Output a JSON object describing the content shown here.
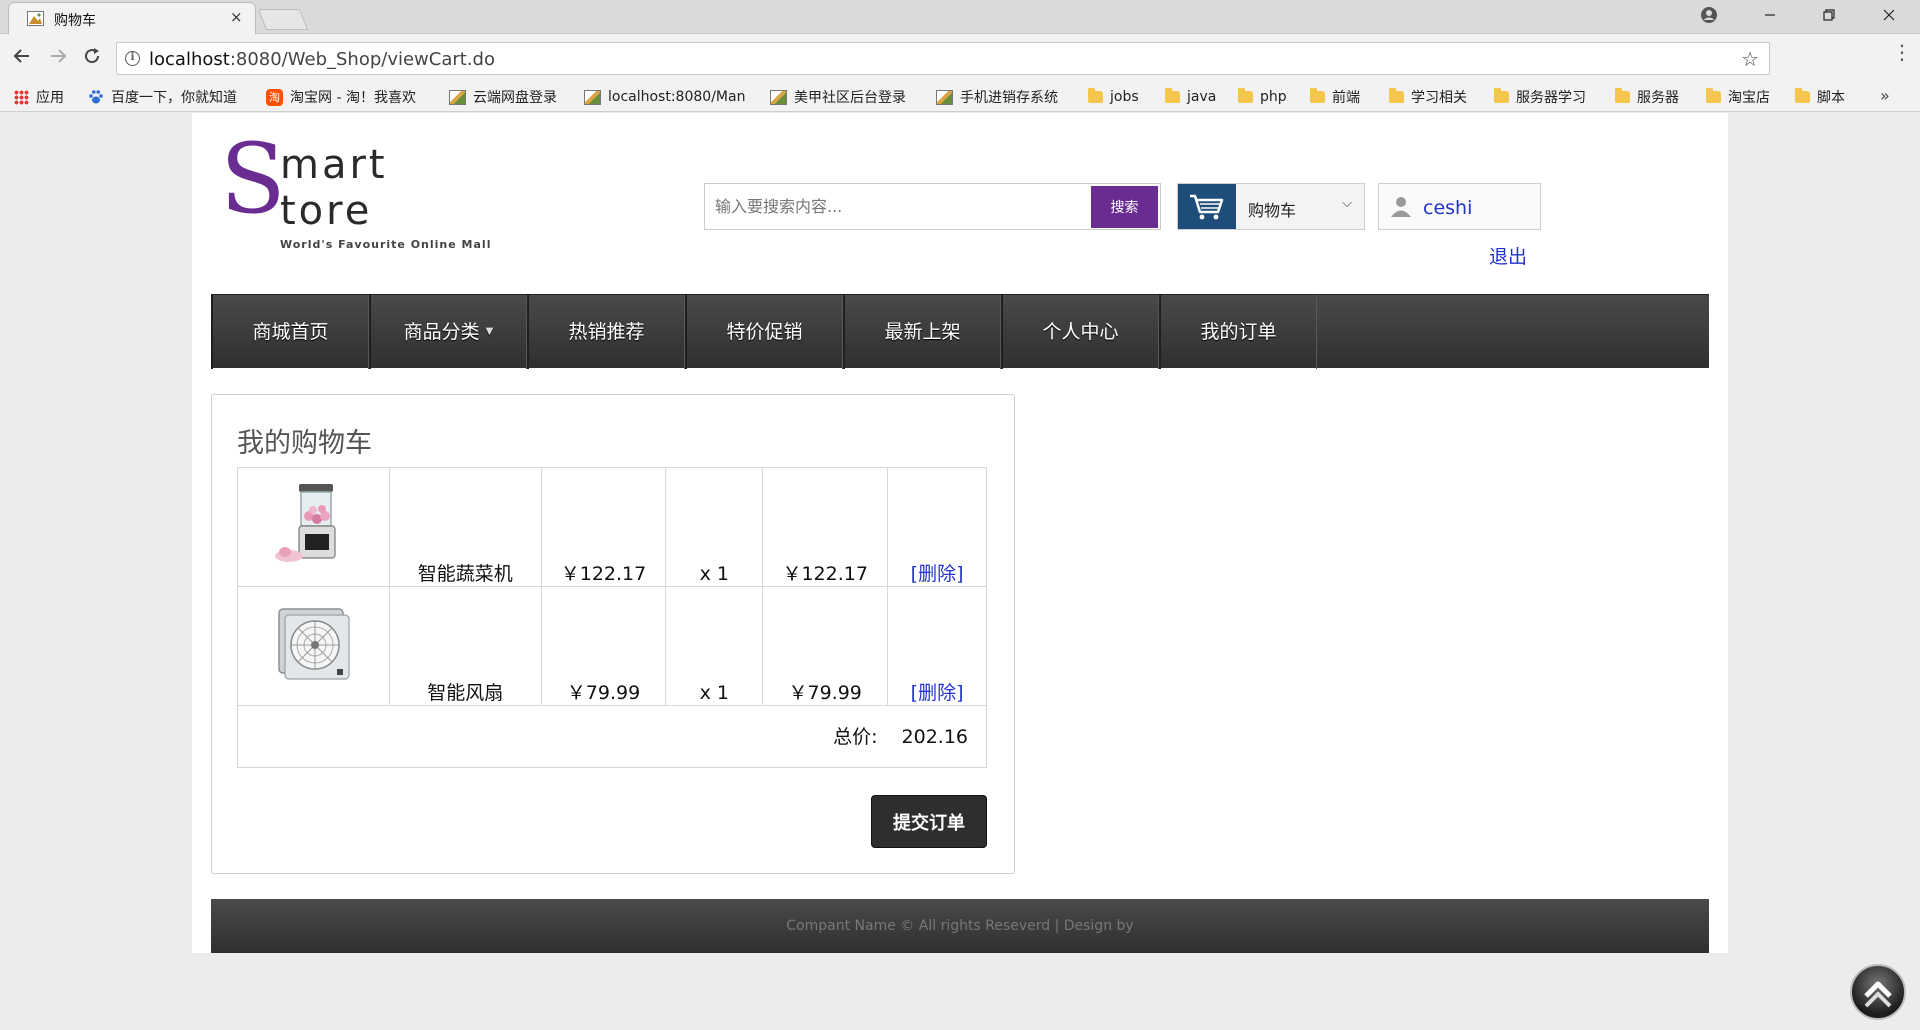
{
  "browser": {
    "tab_title": "购物车",
    "tab_close": "×",
    "url_host": "localhost",
    "url_rest": ":8080/Web_Shop/viewCart.do",
    "bookmarks": [
      {
        "label": "应用",
        "icon": "apps-grid-icon"
      },
      {
        "label": "百度一下，你就知道",
        "icon": "baidu-paw-icon"
      },
      {
        "label": "淘宝网 - 淘！我喜欢",
        "icon": "taobao-icon"
      },
      {
        "label": "云端网盘登录",
        "icon": "image-icon"
      },
      {
        "label": "localhost:8080/Man",
        "icon": "image-icon"
      },
      {
        "label": "美甲社区后台登录",
        "icon": "image-icon"
      },
      {
        "label": "手机进销存系统",
        "icon": "image-icon"
      },
      {
        "label": "jobs",
        "icon": "folder-icon"
      },
      {
        "label": "java",
        "icon": "folder-icon"
      },
      {
        "label": "php",
        "icon": "folder-icon"
      },
      {
        "label": "前端",
        "icon": "folder-icon"
      },
      {
        "label": "学习相关",
        "icon": "folder-icon"
      },
      {
        "label": "服务器学习",
        "icon": "folder-icon"
      },
      {
        "label": "服务器",
        "icon": "folder-icon"
      },
      {
        "label": "淘宝店",
        "icon": "folder-icon"
      },
      {
        "label": "脚本",
        "icon": "folder-icon"
      }
    ],
    "bookmarks_more": "»"
  },
  "header": {
    "logo_s": "S",
    "logo_mart": "mart",
    "logo_tore": "tore",
    "logo_tagline": "World's Favourite Online Mall",
    "search_placeholder": "输入要搜索内容...",
    "search_button": "搜索",
    "cart_label": "购物车",
    "username": "ceshi",
    "logout": "退出"
  },
  "nav": {
    "items": [
      "商城首页",
      "商品分类",
      "热销推荐",
      "特价促销",
      "最新上架",
      "个人中心",
      "我的订单"
    ]
  },
  "cart": {
    "title": "我的购物车",
    "items": [
      {
        "name": "智能蔬菜机",
        "price": "￥122.17",
        "qty": "x 1",
        "subtotal": "￥122.17",
        "delete": "[删除]"
      },
      {
        "name": "智能风扇",
        "price": "￥79.99",
        "qty": "x 1",
        "subtotal": "￥79.99",
        "delete": "[删除]"
      }
    ],
    "total_label": "总价:",
    "total_value": "202.16",
    "submit": "提交订单"
  },
  "footer": {
    "text": "Compant Name © All rights Reseverd | Design by"
  },
  "colors": {
    "brand_purple": "#6a2c91",
    "nav_dark": "#3a3a3a",
    "link_blue": "#2233cc",
    "cart_icon_bg": "#1f4d7a"
  }
}
